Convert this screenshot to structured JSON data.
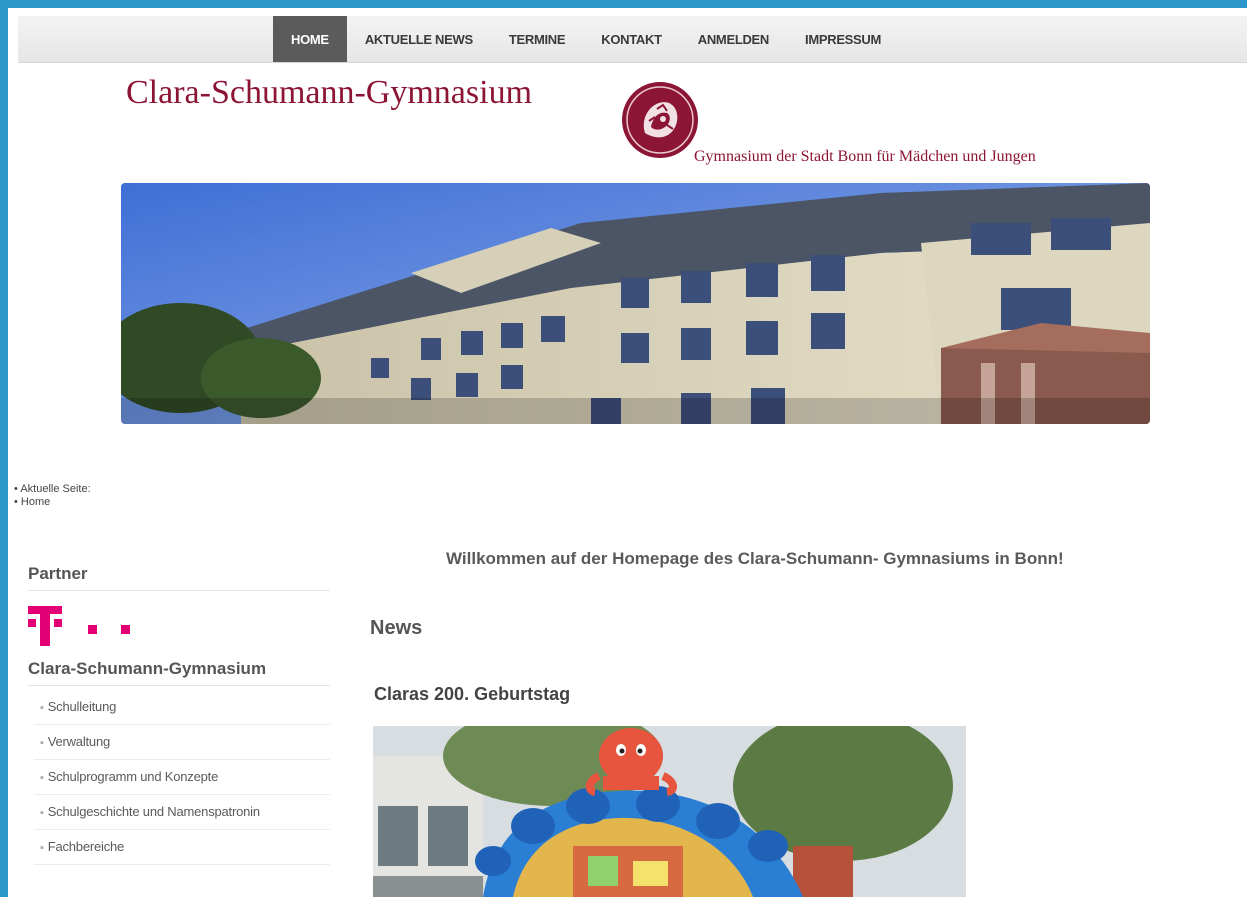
{
  "nav": {
    "items": [
      "HOME",
      "AKTUELLE NEWS",
      "TERMINE",
      "KONTAKT",
      "ANMELDEN",
      "IMPRESSUM"
    ],
    "active": "HOME"
  },
  "header": {
    "title": "Clara-Schumann-Gymnasium",
    "subtitle": "Gymnasium der Stadt Bonn für Mädchen und Jungen",
    "banner_icon": "school-building-photo"
  },
  "breadcrumb": {
    "label": "Aktuelle Seite:",
    "current": "Home"
  },
  "welcome": "Willkommen auf der Homepage des Clara-Schumann- Gymnasiums in Bonn!",
  "sidebar": {
    "partner_heading": "Partner",
    "partner_logo_icon": "telekom-logo",
    "section_heading": "Clara-Schumann-Gymnasium",
    "items": [
      "Schulleitung",
      "Verwaltung",
      "Schulprogramm und Konzepte",
      "Schulgeschichte und Namenspatronin",
      "Fachbereiche"
    ]
  },
  "news": {
    "heading": "News",
    "article_title": "Claras 200. Geburtstag",
    "article_image_icon": "bouncy-castle-photo"
  },
  "colors": {
    "frame": "#2b96c9",
    "brand": "#8c1535",
    "telekom": "#e20074",
    "nav_active": "#5b5b5b"
  }
}
